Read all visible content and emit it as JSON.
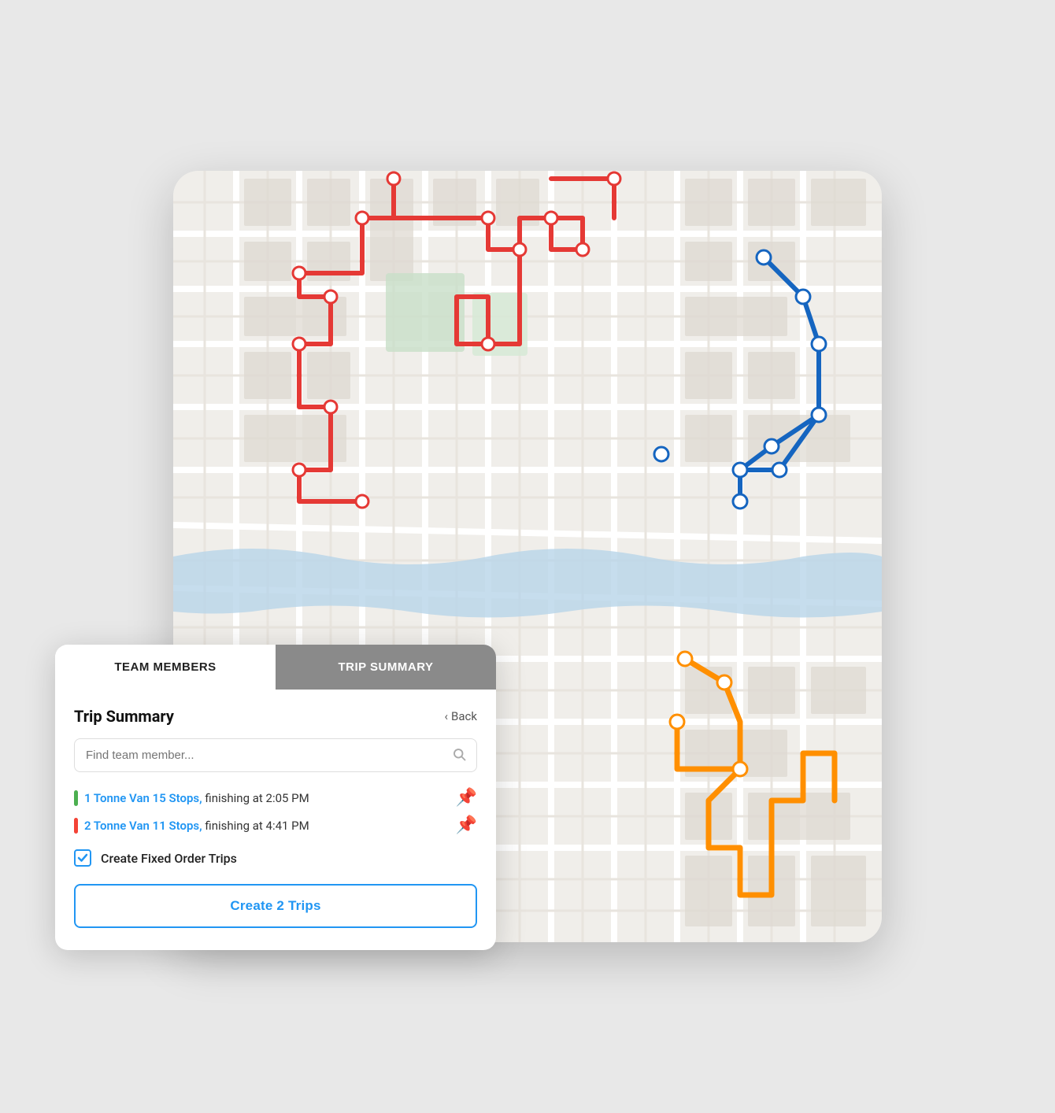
{
  "tabs": [
    {
      "id": "team-members",
      "label": "TEAM MEMBERS",
      "active": false
    },
    {
      "id": "trip-summary",
      "label": "TRIP SUMMARY",
      "active": true
    }
  ],
  "panel": {
    "title": "Trip Summary",
    "back_label": "Back",
    "search_placeholder": "Find team member...",
    "trips": [
      {
        "id": "trip-1",
        "color": "#4CAF50",
        "link_text": "1 Tonne Van 15 Stops,",
        "finishing_text": "finishing at 2:05 PM"
      },
      {
        "id": "trip-2",
        "color": "#F44336",
        "link_text": "2 Tonne Van 11 Stops,",
        "finishing_text": "finishing at 4:41 PM"
      }
    ],
    "checkbox_label": "Create Fixed Order Trips",
    "checkbox_checked": true,
    "create_button_label": "Create 2 Trips"
  },
  "icons": {
    "back_chevron": "‹",
    "search": "🔍",
    "pin": "📌",
    "checkmark": "✓"
  }
}
